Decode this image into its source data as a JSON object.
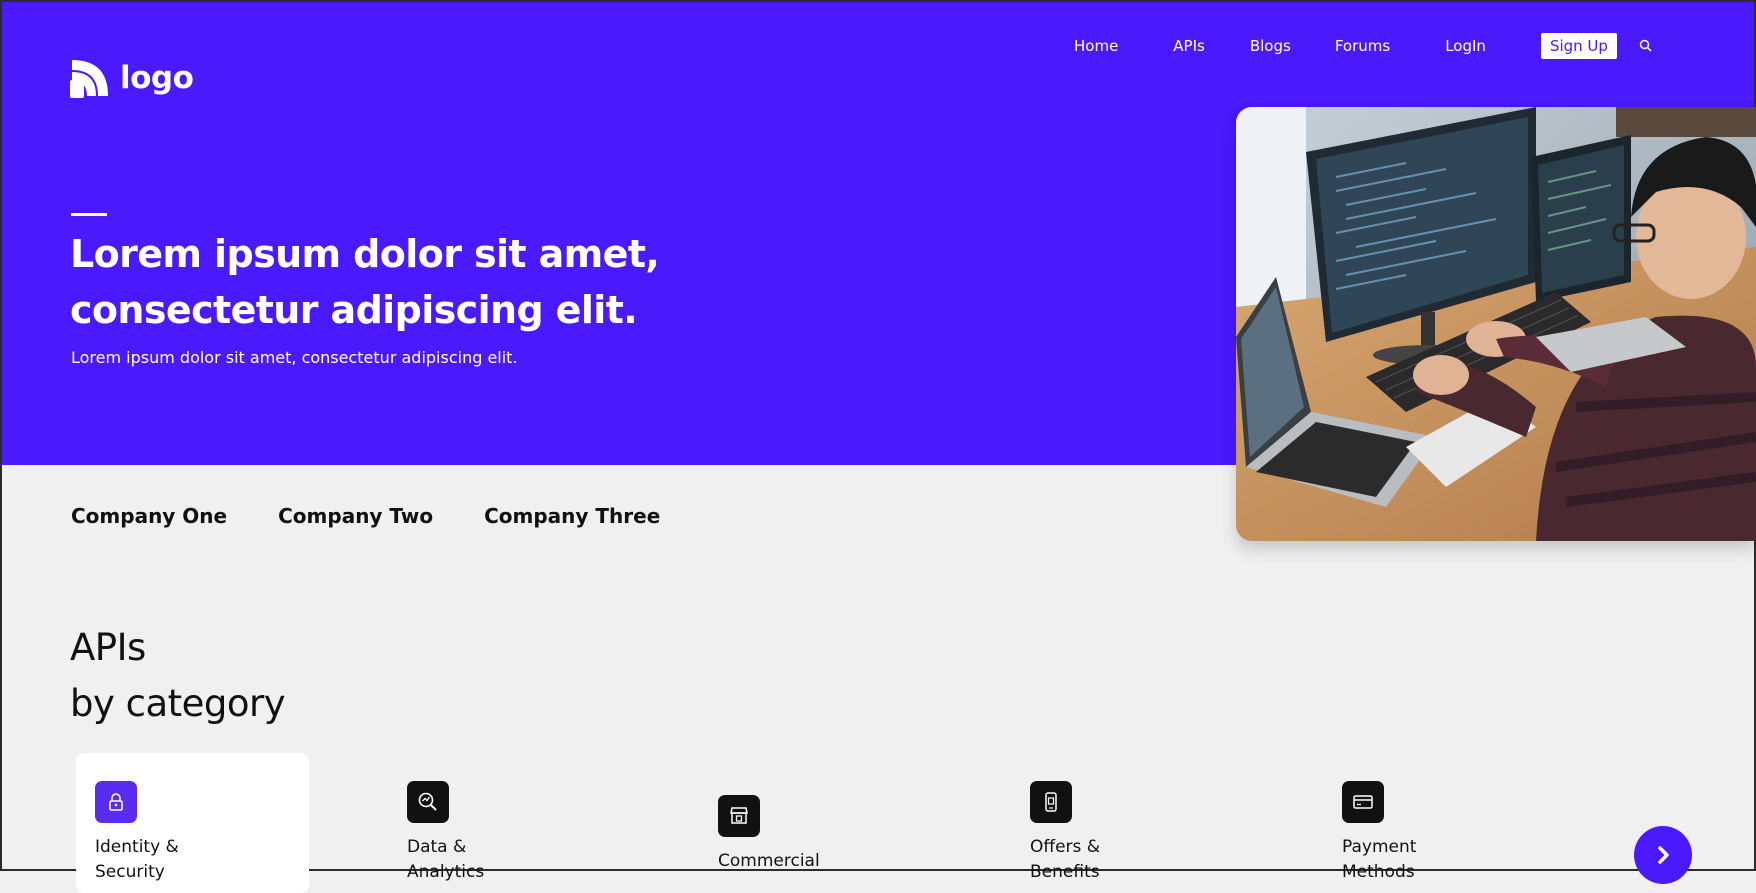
{
  "header": {
    "logo_text": "logo",
    "nav": {
      "home": "Home",
      "apis": "APIs",
      "blogs": "Blogs",
      "forums": "Forums",
      "login": "LogIn",
      "signup": "Sign Up"
    }
  },
  "hero": {
    "title_line1": "Lorem ipsum dolor sit amet,",
    "title_line2": "consectetur adipiscing elit.",
    "subtitle": "Lorem ipsum dolor sit amet, consectetur adipiscing elit."
  },
  "companies": [
    "Company One",
    "Company Two",
    "Company Three"
  ],
  "apis_section": {
    "heading_line1": "APIs",
    "heading_line2": "by category",
    "categories": [
      {
        "label": "Identity & Security",
        "icon": "lock-icon"
      },
      {
        "label": "Data & Analytics",
        "icon": "magnifier-chart-icon"
      },
      {
        "label": "Commercial",
        "icon": "storefront-icon"
      },
      {
        "label": "Offers & Benefits",
        "icon": "phone-offer-icon"
      },
      {
        "label": "Payment Methods",
        "icon": "credit-card-icon"
      }
    ]
  },
  "colors": {
    "brand": "#4a1afc",
    "page_bg": "#f1f0f0",
    "active_icon": "#5a2cf0",
    "text": "#111111"
  }
}
